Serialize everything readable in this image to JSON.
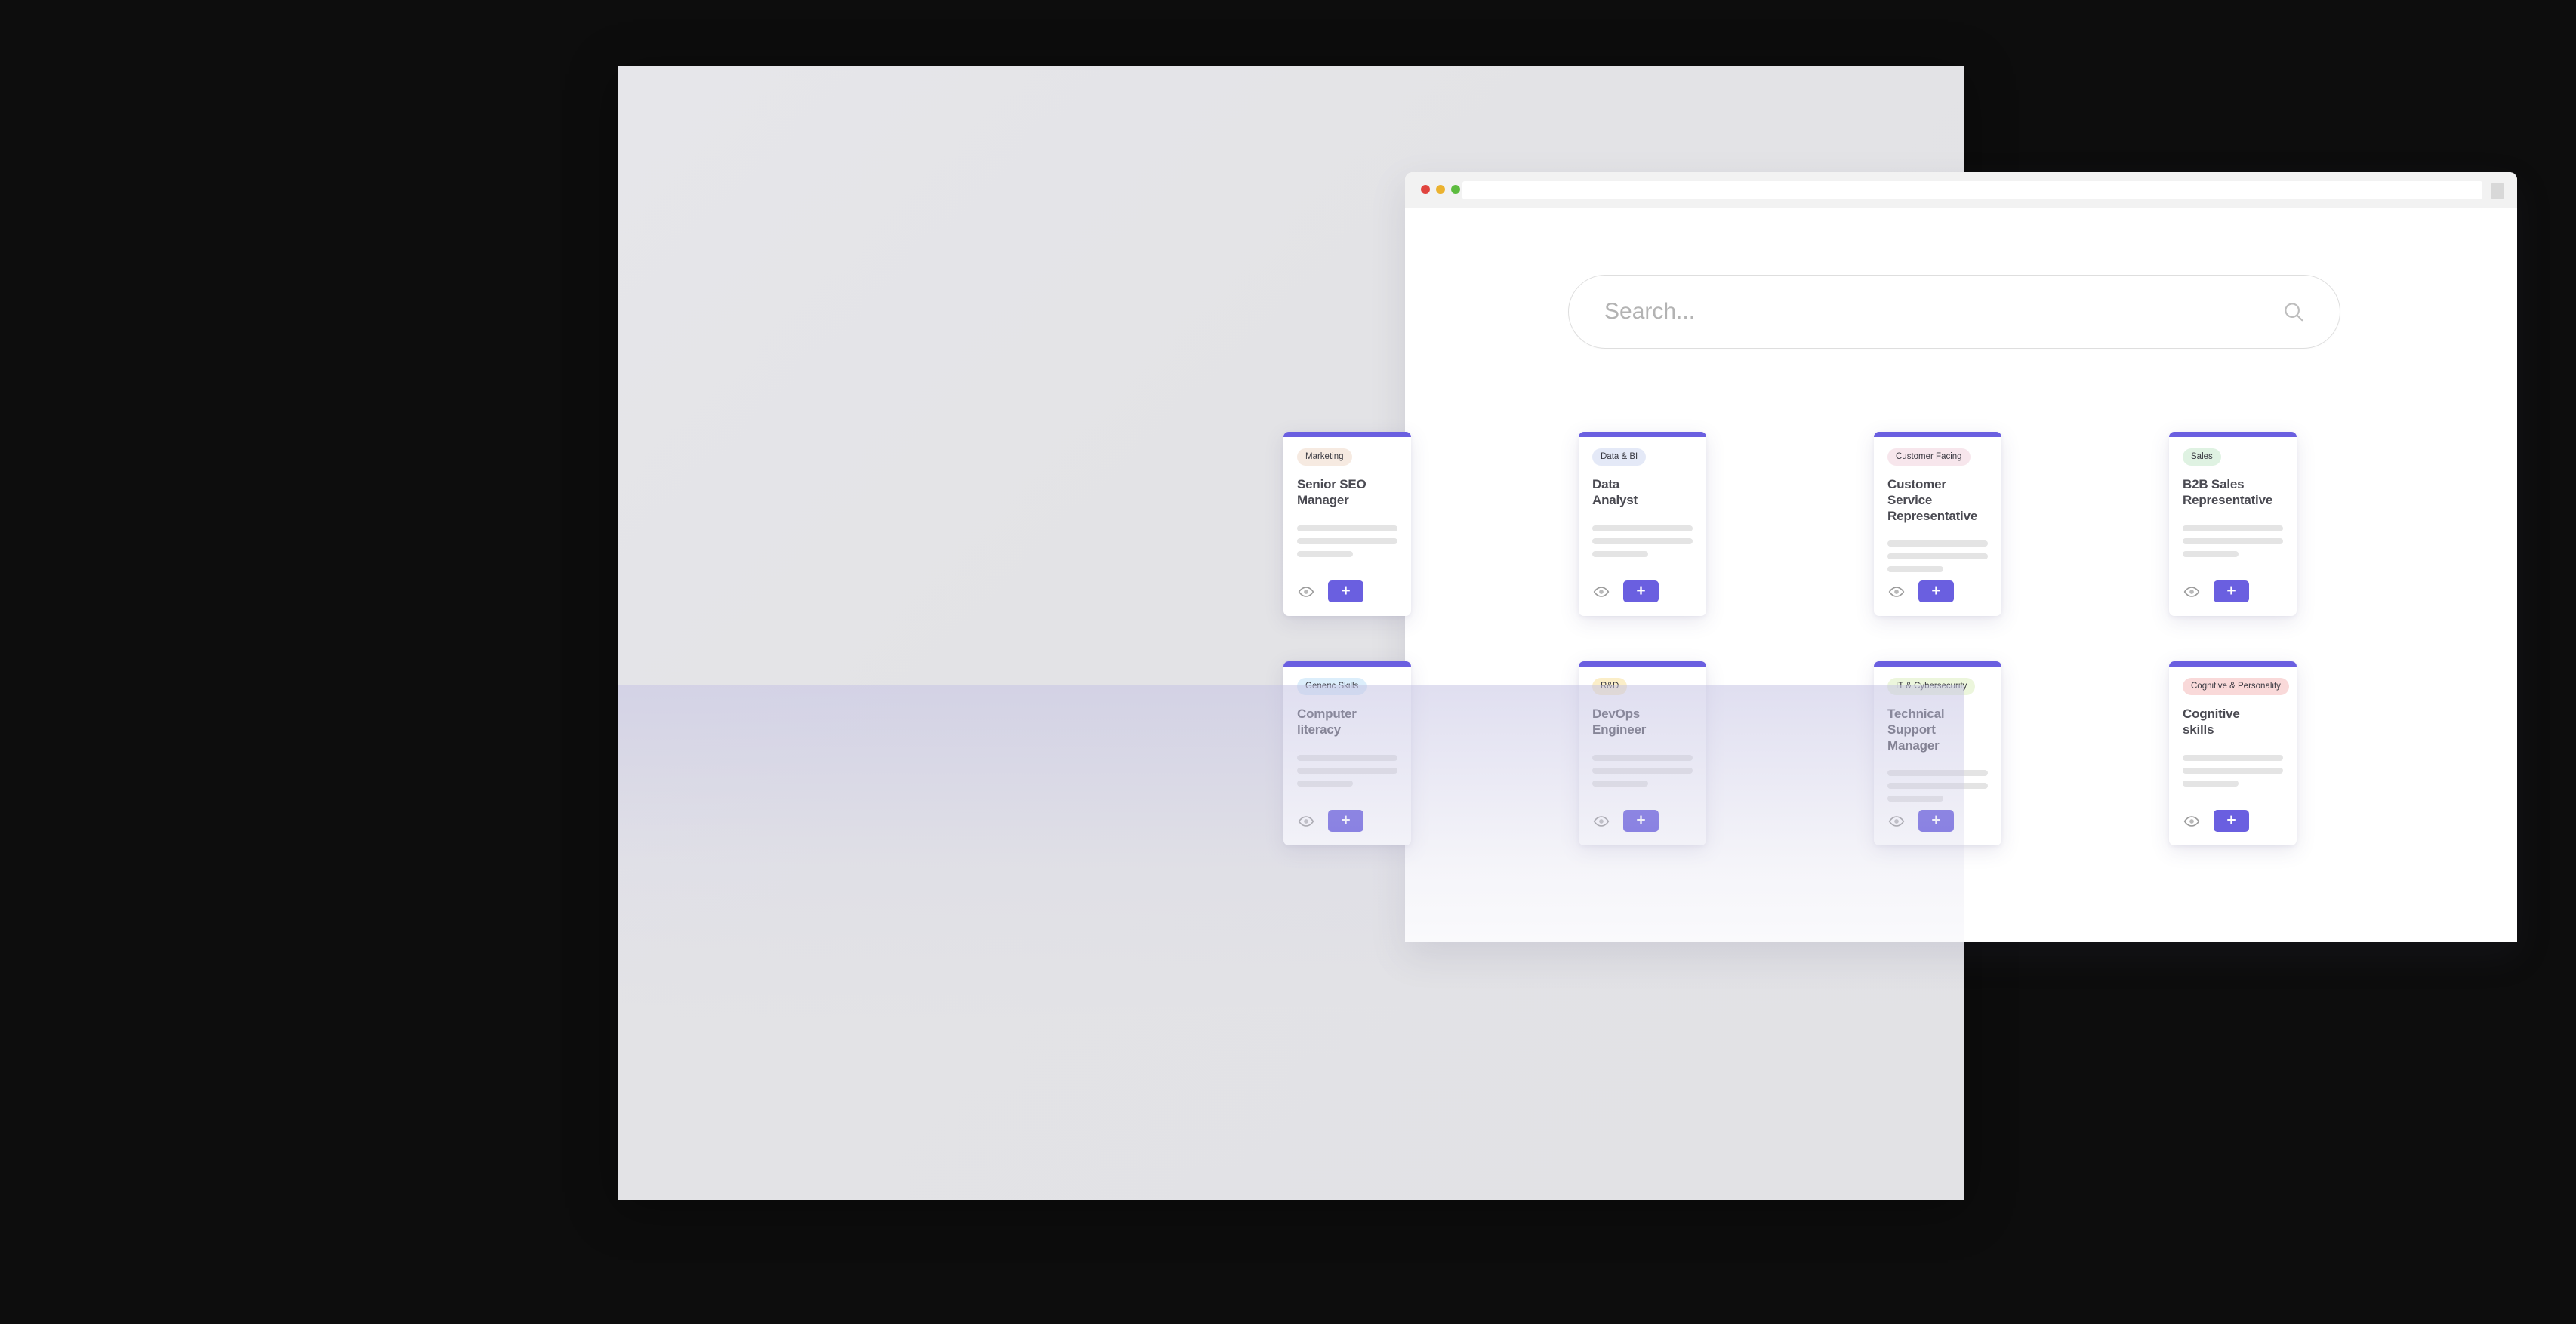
{
  "browser": {
    "url_value": "",
    "traffic_lights": [
      "close-dot",
      "minimize-dot",
      "maximize-dot"
    ],
    "menu_icon": "menu-square-icon"
  },
  "search": {
    "placeholder": "Search...",
    "value": "",
    "icon": "search-icon"
  },
  "card_defaults": {
    "accent_color": "#6a5fe0",
    "add_label": "+",
    "eye_icon": "eye-icon",
    "skeleton_widths": [
      "100%",
      "100%",
      "56%"
    ]
  },
  "cards": [
    {
      "badge": "Marketing",
      "badge_bg": "#f6eae1",
      "title": "Senior SEO\nManager"
    },
    {
      "badge": "Data & BI",
      "badge_bg": "#e4e9f7",
      "title": "Data\nAnalyst"
    },
    {
      "badge": "Customer Facing",
      "badge_bg": "#f7e6ec",
      "title": "Customer Service\nRepresentative"
    },
    {
      "badge": "Sales",
      "badge_bg": "#dff2e2",
      "title": "B2B Sales\nRepresentative"
    },
    {
      "badge": "Generic Skills",
      "badge_bg": "#dceefb",
      "title": "Computer\nliteracy"
    },
    {
      "badge": "R&D",
      "badge_bg": "#fbeec8",
      "title": "DevOps\nEngineer"
    },
    {
      "badge": "IT & Cybersecurity",
      "badge_bg": "#ecf6dc",
      "title": "Technical Support\nManager"
    },
    {
      "badge": "Cognitive & Personality",
      "badge_bg": "#f9d9d9",
      "title": "Cognitive\nskills"
    }
  ]
}
